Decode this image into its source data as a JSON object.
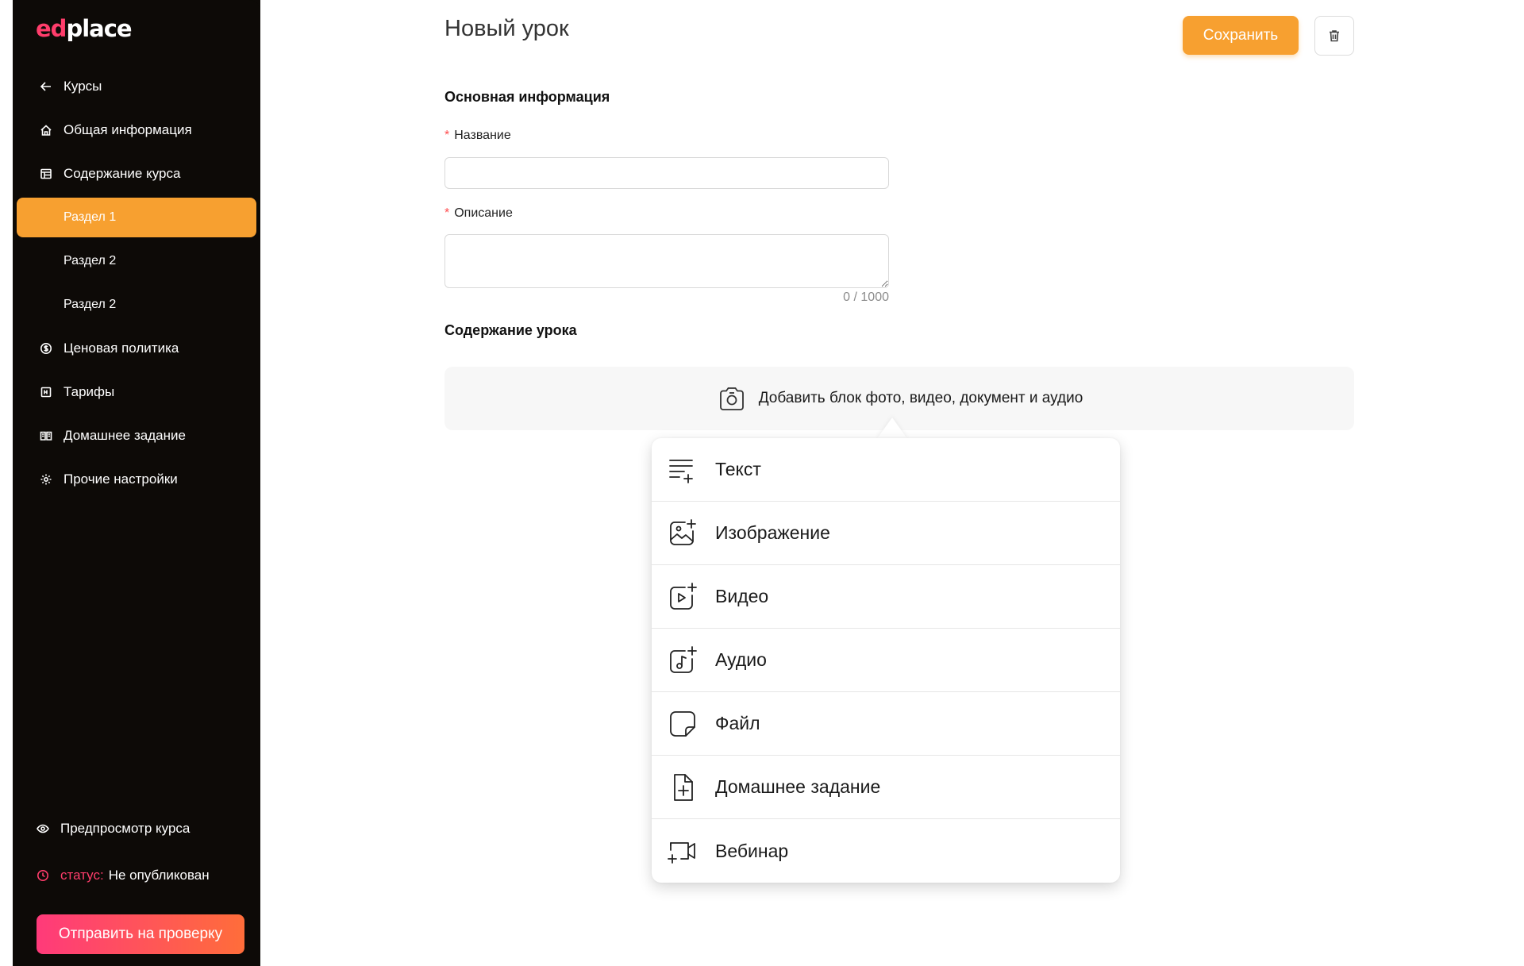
{
  "brand": {
    "logo_ed": "ed",
    "logo_place": "place",
    "accent": "#f7a030",
    "pink": "#ff3d6b"
  },
  "sidebar": {
    "back": {
      "label": "Курсы",
      "icon": "arrow-left-icon"
    },
    "items": [
      {
        "label": "Общая информация",
        "icon": "home-icon"
      },
      {
        "label": "Содержание курса",
        "icon": "layout-icon"
      }
    ],
    "sections": [
      {
        "label": "Раздел 1",
        "active": true
      },
      {
        "label": "Раздел 2",
        "active": false
      },
      {
        "label": "Раздел 2",
        "active": false
      }
    ],
    "items2": [
      {
        "label": "Ценовая политика",
        "icon": "dollar-icon"
      },
      {
        "label": "Тарифы",
        "icon": "table-icon"
      },
      {
        "label": "Домашнее задание",
        "icon": "book-icon"
      },
      {
        "label": "Прочие настройки",
        "icon": "gear-icon"
      }
    ],
    "preview": {
      "label": "Предпросмотр курса",
      "icon": "eye-icon"
    },
    "status": {
      "prefix": "статус:",
      "value": "Не опубликован",
      "icon": "clock-icon"
    },
    "submit_label": "Отправить на проверку"
  },
  "header": {
    "title": "Новый урок",
    "save_label": "Сохранить",
    "delete_icon": "trash-icon"
  },
  "form": {
    "basic_title": "Основная информация",
    "name_label": "Название",
    "name_value": "",
    "desc_label": "Описание",
    "desc_value": "",
    "counter": "0 / 1000",
    "required_mark": "*"
  },
  "content": {
    "title": "Содержание урока",
    "add_block_label": "Добавить блок фото, видео, документ и аудио",
    "menu": [
      {
        "label": "Текст",
        "icon": "text-add-icon"
      },
      {
        "label": "Изображение",
        "icon": "image-add-icon"
      },
      {
        "label": "Видео",
        "icon": "video-add-icon"
      },
      {
        "label": "Аудио",
        "icon": "audio-add-icon"
      },
      {
        "label": "Файл",
        "icon": "file-icon"
      },
      {
        "label": "Домашнее задание",
        "icon": "document-add-icon"
      },
      {
        "label": "Вебинар",
        "icon": "webinar-icon"
      }
    ]
  }
}
